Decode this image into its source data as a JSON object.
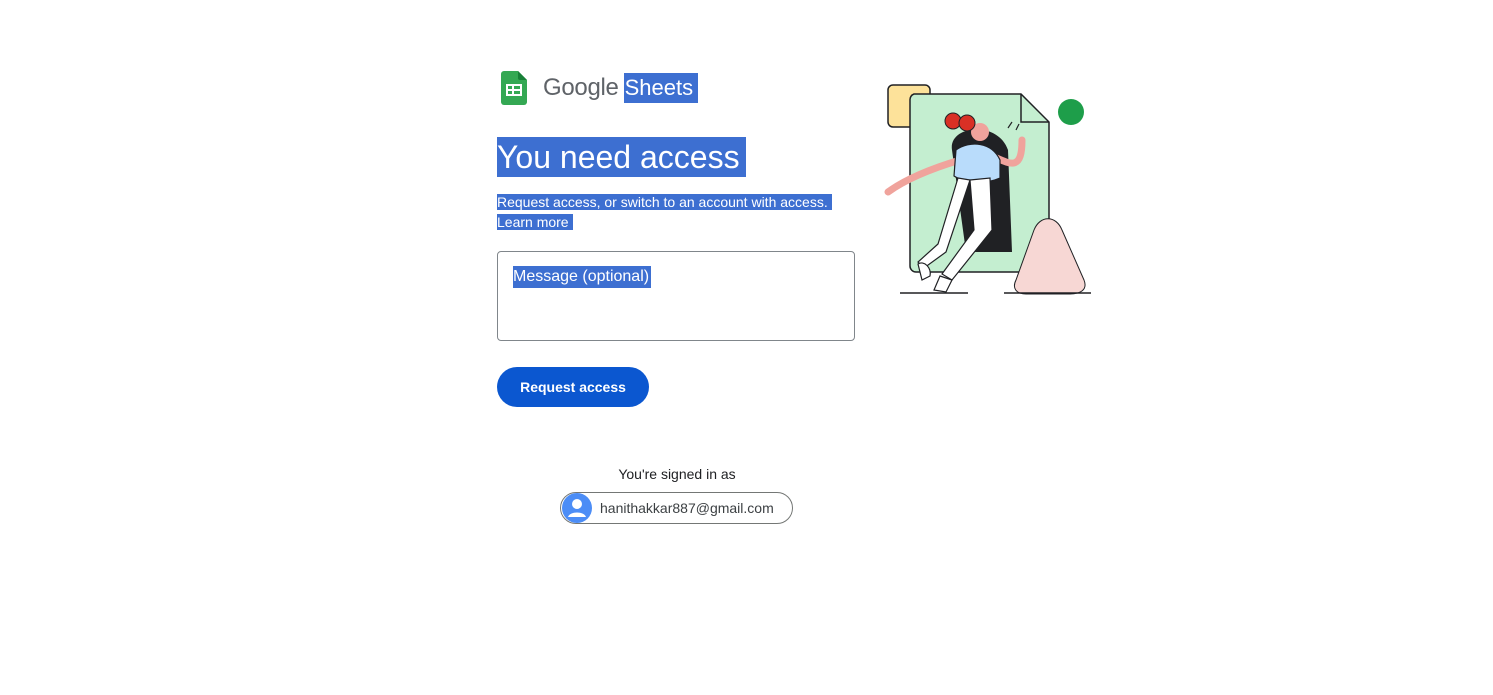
{
  "header": {
    "brand": "Google",
    "product": "Sheets"
  },
  "main": {
    "title": "You need access",
    "description": "Request access, or switch to an account with access.",
    "learn_more": "Learn more",
    "message_placeholder": "Message (optional)",
    "request_button": "Request access"
  },
  "account": {
    "signed_in_label": "You're signed in as",
    "email": "hanithakkar887@gmail.com"
  },
  "icons": {
    "product_icon": "google-sheets-icon",
    "avatar_icon": "default-avatar-icon",
    "illustration": "person-walking-through-door-illustration"
  },
  "colors": {
    "selection_highlight": "#3d6fd1",
    "primary_button": "#0b57d0",
    "sheets_green": "#34a853"
  }
}
